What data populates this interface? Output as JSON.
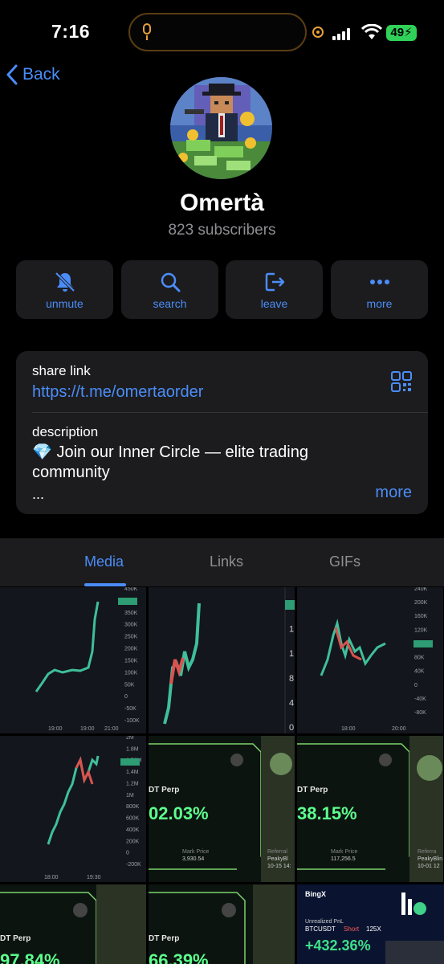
{
  "status": {
    "time": "7:16",
    "battery": "49"
  },
  "nav": {
    "back_label": "Back"
  },
  "channel": {
    "name": "Omertà",
    "subscribers": "823 subscribers"
  },
  "actions": [
    {
      "label": "unmute",
      "icon": "bell-slash-icon"
    },
    {
      "label": "search",
      "icon": "search-icon"
    },
    {
      "label": "leave",
      "icon": "leave-icon"
    },
    {
      "label": "more",
      "icon": "ellipsis-icon"
    }
  ],
  "info": {
    "share_label": "share link",
    "share_url": "https://t.me/omertaorder",
    "description_label": "description",
    "description_line1": "💎 Join our Inner Circle — elite trading",
    "description_line2": "community",
    "description_ellipsis": "...",
    "more_label": "more"
  },
  "tabs": [
    {
      "label": "Media",
      "active": true
    },
    {
      "label": "Links",
      "active": false
    },
    {
      "label": "GIFs",
      "active": false
    }
  ],
  "media": {
    "chart1": {
      "y_ticks": [
        "450K",
        "399K",
        "350K",
        "300K",
        "250K",
        "200K",
        "150K",
        "100K",
        "50K",
        "0",
        "-50K",
        "-100K"
      ],
      "x_ticks": [
        "19:00",
        "21:00"
      ]
    },
    "chart2": {
      "y_ticks": [
        "2",
        "1",
        "1",
        "8",
        "4",
        "0"
      ]
    },
    "chart3": {
      "y_ticks": [
        "240K",
        "200K",
        "160K",
        "120K",
        "97.7K",
        "80K",
        "40K",
        "0",
        "-40K",
        "-80K"
      ],
      "x_ticks": [
        "18:00",
        "20:00"
      ]
    },
    "chart4": {
      "y_ticks": [
        "2M",
        "1.8M",
        "1.56M",
        "1.4M",
        "1.2M",
        "1M",
        "800K",
        "600K",
        "400K",
        "200K",
        "0",
        "-200K"
      ],
      "x_ticks": [
        "18:00",
        "19:30"
      ]
    },
    "pnl1": {
      "pair": "DT Perp",
      "value": "02.03%",
      "mark_label": "Mark Price",
      "mark_value": "3,930.54",
      "ref_label": "Referral",
      "ref_name": "PeakyBl",
      "ref_date": "10-15 14:"
    },
    "pnl2": {
      "pair": "DT Perp",
      "value": "38.15%",
      "mark_label": "Mark Price",
      "mark_value": "117,256.5",
      "ref_label": "Referra",
      "ref_name": "PeakyBlin",
      "ref_date": "10-01 12"
    },
    "pnl3": {
      "pair": "DT Perp",
      "value": "97.84%"
    },
    "pnl4": {
      "pair": "DT Perp",
      "value": "66.39%"
    },
    "bingx": {
      "brand": "BingX",
      "label": "Unrealized PnL",
      "pair": "BTCUSDT",
      "side": "Short",
      "leverage": "125X",
      "value": "+432.36%"
    }
  }
}
